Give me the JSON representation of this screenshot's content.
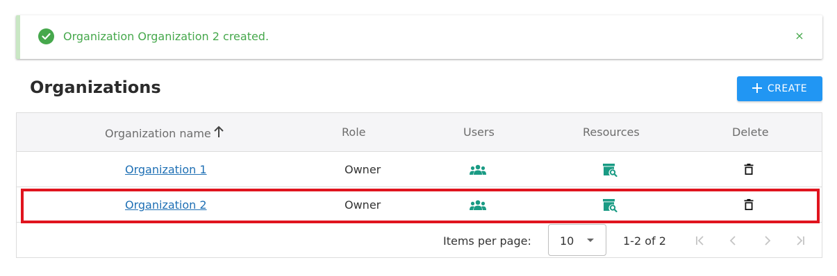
{
  "toast": {
    "message": "Organization Organization 2 created.",
    "close_label": "×",
    "color": "#46a84c"
  },
  "header": {
    "title": "Organizations",
    "create_label": "CREATE",
    "create_color": "#2196f3"
  },
  "table": {
    "columns": [
      "Organization name",
      "Role",
      "Users",
      "Resources",
      "Delete"
    ],
    "sort_icon": "arrow-up-icon",
    "rows": [
      {
        "name": "Organization 1",
        "role": "Owner",
        "users_icon": "users-icon",
        "resources_icon": "resources-search-icon",
        "delete_icon": "trash-icon"
      },
      {
        "name": "Organization 2",
        "role": "Owner",
        "users_icon": "users-icon",
        "resources_icon": "resources-search-icon",
        "delete_icon": "trash-icon"
      }
    ],
    "icon_color": "#1a9b84",
    "highlight_color": "#e0141e"
  },
  "paginator": {
    "items_per_page_label": "Items per page:",
    "page_size": "10",
    "range_label": "1-2 of 2"
  }
}
